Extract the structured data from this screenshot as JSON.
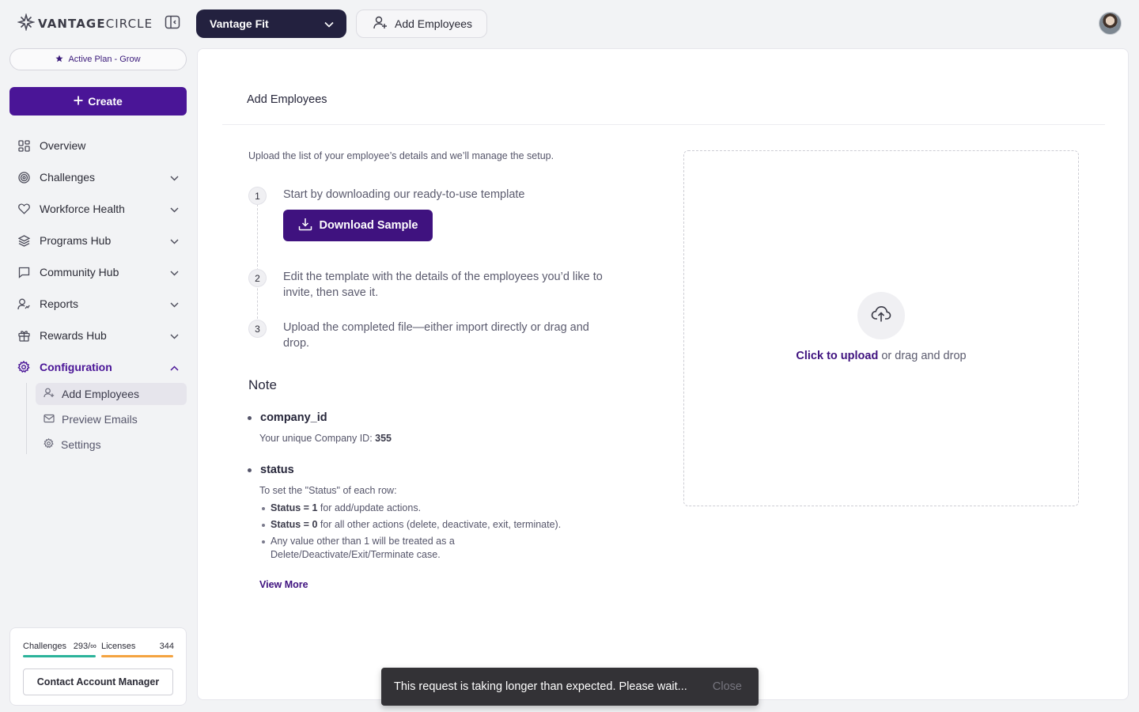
{
  "brand": {
    "logo_text_bold": "VANTAGE",
    "logo_text_rest": "CIRCLE",
    "accent": "#4a1597"
  },
  "header": {
    "product": "Vantage Fit",
    "add_employees": "Add Employees"
  },
  "sidebar": {
    "plan": "Active Plan - Grow",
    "create_label": "Create",
    "nav": [
      {
        "label": "Overview",
        "icon": "grid-icon"
      },
      {
        "label": "Challenges",
        "icon": "target-icon"
      },
      {
        "label": "Workforce Health",
        "icon": "heart-icon"
      },
      {
        "label": "Programs Hub",
        "icon": "layers-icon"
      },
      {
        "label": "Community Hub",
        "icon": "message-icon"
      },
      {
        "label": "Reports",
        "icon": "user-chart-icon"
      },
      {
        "label": "Rewards Hub",
        "icon": "gift-icon"
      },
      {
        "label": "Configuration",
        "icon": "gear-icon"
      }
    ],
    "subnav": [
      {
        "label": "Add Employees",
        "icon": "user-plus-icon"
      },
      {
        "label": "Preview Emails",
        "icon": "mail-icon"
      },
      {
        "label": "Settings",
        "icon": "gear-icon"
      }
    ],
    "usage": {
      "challenges_label": "Challenges",
      "challenges_value": "293/∞",
      "licenses_label": "Licenses",
      "licenses_value": "344",
      "challenges_color": "#2bb39a",
      "licenses_color": "#f4a340"
    },
    "contact_label": "Contact Account Manager"
  },
  "main": {
    "title": "Add Employees",
    "intro": "Upload the list of your employee’s details and we’ll manage the setup.",
    "steps": [
      {
        "num": "1",
        "text": "Start by downloading our ready-to-use template"
      },
      {
        "num": "2",
        "text": "Edit the template with the details of the employees you’d like to invite, then save it."
      },
      {
        "num": "3",
        "text": "Upload the completed file—either import directly or drag and drop."
      }
    ],
    "download_label": "Download Sample",
    "note_title": "Note",
    "note": {
      "company_key": "company_id",
      "company_text": "Your unique Company ID: ",
      "company_id": "355",
      "status_key": "status",
      "status_text": "To set the \"Status\" of each row:",
      "status_items": [
        {
          "bold": "Status = 1",
          "text": " for add/update actions."
        },
        {
          "bold": "Status = 0",
          "text": " for all other actions (delete, deactivate, exit, terminate)."
        },
        {
          "bold": "",
          "text": "Any value other than 1 will be treated as a Delete/Deactivate/Exit/Terminate case."
        }
      ],
      "view_more": "View More"
    },
    "upload": {
      "link": "Click to upload",
      "rest": " or drag and drop"
    }
  },
  "toast": {
    "message": "This request is taking longer than expected. Please wait...",
    "close": "Close"
  }
}
